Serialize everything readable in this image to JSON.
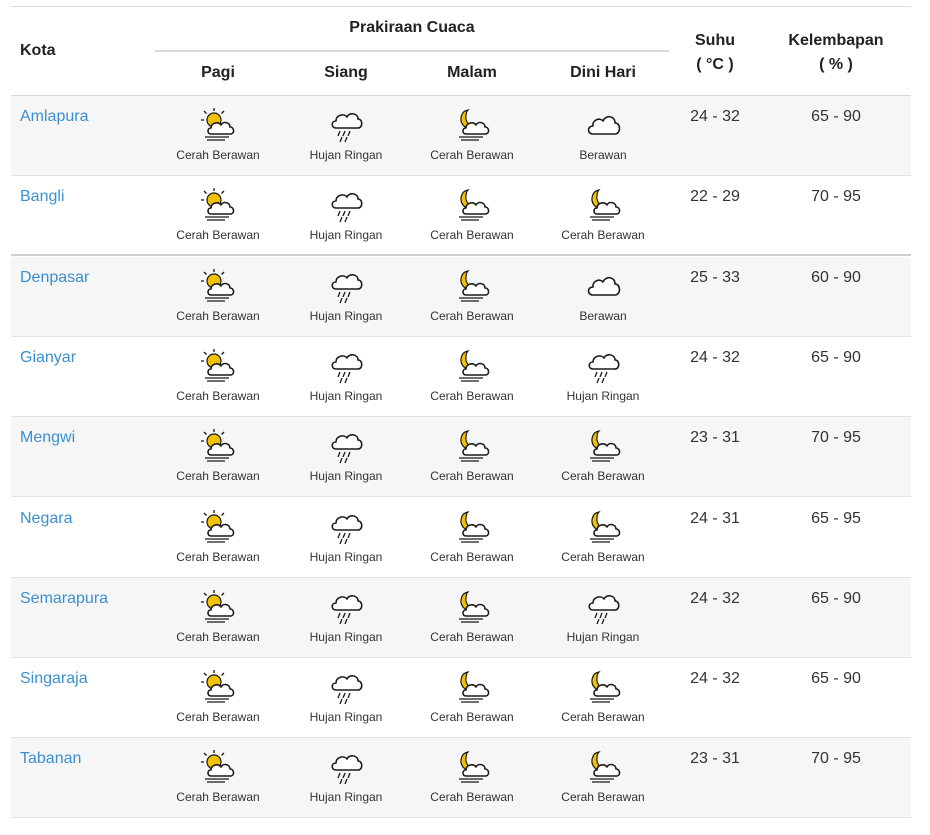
{
  "header": {
    "kota": "Kota",
    "forecast_group": "Prakiraan Cuaca",
    "periods": [
      "Pagi",
      "Siang",
      "Malam",
      "Dini Hari"
    ],
    "suhu_title": "Suhu",
    "suhu_unit": "( °C )",
    "kelembapan_title": "Kelembapan",
    "kelembapan_unit": "( % )"
  },
  "rows": [
    {
      "city": "Amlapura",
      "forecast": [
        {
          "icon": "partly-sunny-haze-icon",
          "label": "Cerah Berawan"
        },
        {
          "icon": "rain-cloud-icon",
          "label": "Hujan Ringan"
        },
        {
          "icon": "moon-cloud-icon",
          "label": "Cerah Berawan"
        },
        {
          "icon": "cloud-icon",
          "label": "Berawan"
        }
      ],
      "temp": "24 - 32",
      "humidity": "65 - 90"
    },
    {
      "city": "Bangli",
      "forecast": [
        {
          "icon": "partly-sunny-haze-icon",
          "label": "Cerah Berawan"
        },
        {
          "icon": "rain-cloud-icon",
          "label": "Hujan Ringan"
        },
        {
          "icon": "moon-cloud-haze-icon",
          "label": "Cerah Berawan"
        },
        {
          "icon": "moon-cloud-haze-icon",
          "label": "Cerah Berawan"
        }
      ],
      "temp": "22 - 29",
      "humidity": "70 - 95"
    },
    {
      "city": "Denpasar",
      "forecast": [
        {
          "icon": "partly-sunny-haze-icon",
          "label": "Cerah Berawan"
        },
        {
          "icon": "rain-cloud-icon",
          "label": "Hujan Ringan"
        },
        {
          "icon": "moon-cloud-haze-icon",
          "label": "Cerah Berawan"
        },
        {
          "icon": "cloud-icon",
          "label": "Berawan"
        }
      ],
      "temp": "25 - 33",
      "humidity": "60 - 90"
    },
    {
      "city": "Gianyar",
      "forecast": [
        {
          "icon": "partly-sunny-haze-icon",
          "label": "Cerah Berawan"
        },
        {
          "icon": "rain-cloud-icon",
          "label": "Hujan Ringan"
        },
        {
          "icon": "moon-cloud-haze-icon",
          "label": "Cerah Berawan"
        },
        {
          "icon": "rain-cloud-icon",
          "label": "Hujan Ringan"
        }
      ],
      "temp": "24 - 32",
      "humidity": "65 - 90"
    },
    {
      "city": "Mengwi",
      "forecast": [
        {
          "icon": "partly-sunny-haze-icon",
          "label": "Cerah Berawan"
        },
        {
          "icon": "rain-cloud-icon",
          "label": "Hujan Ringan"
        },
        {
          "icon": "moon-cloud-haze-icon",
          "label": "Cerah Berawan"
        },
        {
          "icon": "moon-cloud-haze-icon",
          "label": "Cerah Berawan"
        }
      ],
      "temp": "23 - 31",
      "humidity": "70 - 95"
    },
    {
      "city": "Negara",
      "forecast": [
        {
          "icon": "partly-sunny-haze-icon",
          "label": "Cerah Berawan"
        },
        {
          "icon": "rain-cloud-icon",
          "label": "Hujan Ringan"
        },
        {
          "icon": "moon-cloud-haze-icon",
          "label": "Cerah Berawan"
        },
        {
          "icon": "moon-cloud-haze-icon",
          "label": "Cerah Berawan"
        }
      ],
      "temp": "24 - 31",
      "humidity": "65 - 95"
    },
    {
      "city": "Semarapura",
      "forecast": [
        {
          "icon": "partly-sunny-haze-icon",
          "label": "Cerah Berawan"
        },
        {
          "icon": "rain-cloud-icon",
          "label": "Hujan Ringan"
        },
        {
          "icon": "moon-cloud-haze-icon",
          "label": "Cerah Berawan"
        },
        {
          "icon": "rain-cloud-icon",
          "label": "Hujan Ringan"
        }
      ],
      "temp": "24 - 32",
      "humidity": "65 - 90"
    },
    {
      "city": "Singaraja",
      "forecast": [
        {
          "icon": "partly-sunny-haze-icon",
          "label": "Cerah Berawan"
        },
        {
          "icon": "rain-cloud-icon",
          "label": "Hujan Ringan"
        },
        {
          "icon": "moon-cloud-haze-icon",
          "label": "Cerah Berawan"
        },
        {
          "icon": "moon-cloud-haze-icon",
          "label": "Cerah Berawan"
        }
      ],
      "temp": "24 - 32",
      "humidity": "65 - 90"
    },
    {
      "city": "Tabanan",
      "forecast": [
        {
          "icon": "partly-sunny-haze-icon",
          "label": "Cerah Berawan"
        },
        {
          "icon": "rain-cloud-icon",
          "label": "Hujan Ringan"
        },
        {
          "icon": "moon-cloud-haze-icon",
          "label": "Cerah Berawan"
        },
        {
          "icon": "moon-cloud-haze-icon",
          "label": "Cerah Berawan"
        }
      ],
      "temp": "23 - 31",
      "humidity": "70 - 95"
    }
  ],
  "colors": {
    "link": "#3b8fd0",
    "sun": "#f2c200",
    "moon": "#f2c200",
    "row_shade": "#f6f6f6"
  }
}
